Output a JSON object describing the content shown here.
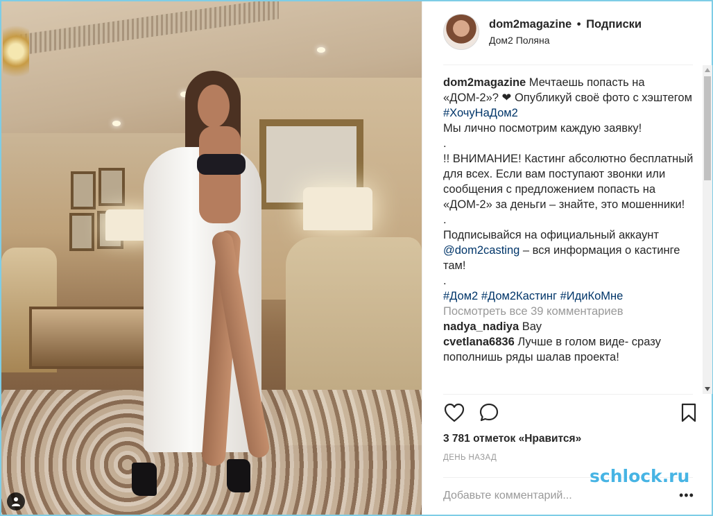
{
  "post": {
    "username": "dom2magazine",
    "separator": "•",
    "follow_label": "Подписки",
    "location": "Дом2 Поляна"
  },
  "caption": {
    "username": "dom2magazine",
    "text1": "Мечтаешь попасть на «ДОМ-2»? ❤ Опубликуй своё фото с хэштегом ",
    "hashtag_main": "#ХочуНаДом2",
    "line2": "Мы лично посмотрим каждую заявку!",
    "dot1": ".",
    "line3": "!! ВНИМАНИЕ! Кастинг абсолютно бесплатный для всех. Если вам поступают звонки или сообщения с предложением попасть на «ДОМ-2» за деньги – знайте, это мошенники!",
    "dot2": ".",
    "line4_pre": "Подписывайся на официальный аккаунт ",
    "mention": "@dom2casting",
    "line4_post": " – вся информация о кастинге там!",
    "dot3": ".",
    "tags": [
      "#Дом2",
      "#Дом2Кастинг",
      "#ИдиКоМне"
    ]
  },
  "view_all_comments": "Посмотреть все 39 комментариев",
  "comments": [
    {
      "user": "nadya_nadiya",
      "text": "Вау"
    },
    {
      "user": "cvetlana6836",
      "text": "Лучше в голом виде- сразу пополнишь ряды шалав проекта!"
    }
  ],
  "likes_text": "3 781 отметок «Нравится»",
  "time_text": "ДЕНЬ НАЗАД",
  "add_comment_placeholder": "Добавьте комментарий...",
  "more_label": "•••",
  "watermark": "schlock.ru",
  "icons": {
    "heart": "heart-icon",
    "comment": "comment-icon",
    "bookmark": "bookmark-icon",
    "user_tag": "user-tag-icon"
  },
  "colors": {
    "border": "#7ecde6",
    "link": "#003569",
    "muted": "#999999",
    "watermark": "#47b4e4"
  }
}
